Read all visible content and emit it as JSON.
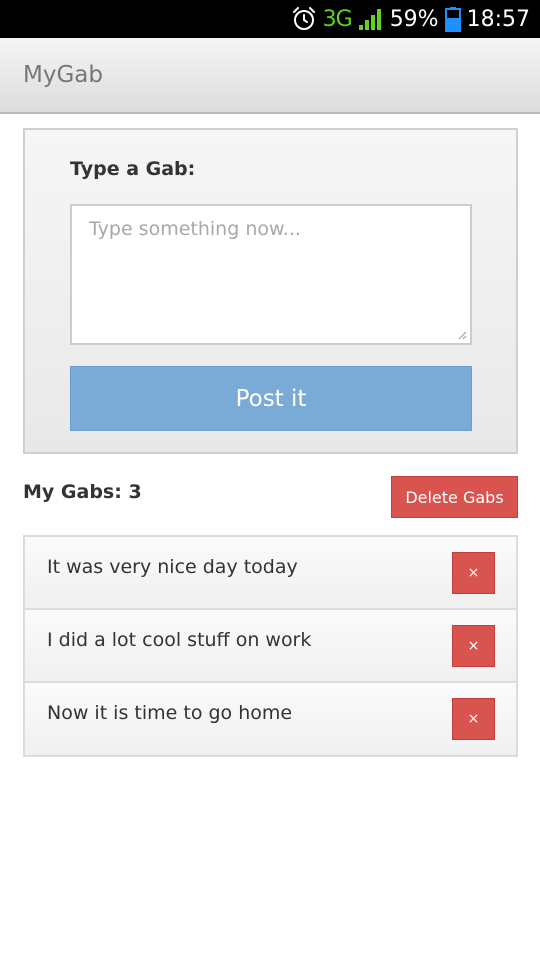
{
  "status_bar": {
    "network": "3G",
    "battery_percent": "59%",
    "time": "18:57",
    "icons": [
      "alarm-icon",
      "signal-icon",
      "battery-icon"
    ]
  },
  "app": {
    "title": "MyGab"
  },
  "compose": {
    "label": "Type a Gab:",
    "value": "",
    "placeholder": "Type something now...",
    "post_label": "Post it"
  },
  "gabs": {
    "count_label": "My Gabs: 3",
    "delete_all_label": "Delete Gabs",
    "items": [
      {
        "text": "It was very nice day today",
        "delete_label": "×"
      },
      {
        "text": "I did a lot cool stuff on work",
        "delete_label": "×"
      },
      {
        "text": "Now it is time to go home",
        "delete_label": "×"
      }
    ]
  },
  "colors": {
    "primary_button": "#7aaad6",
    "danger_button": "#d9534f",
    "network_indicator": "#5fd31f",
    "battery": "#1e90ff"
  }
}
